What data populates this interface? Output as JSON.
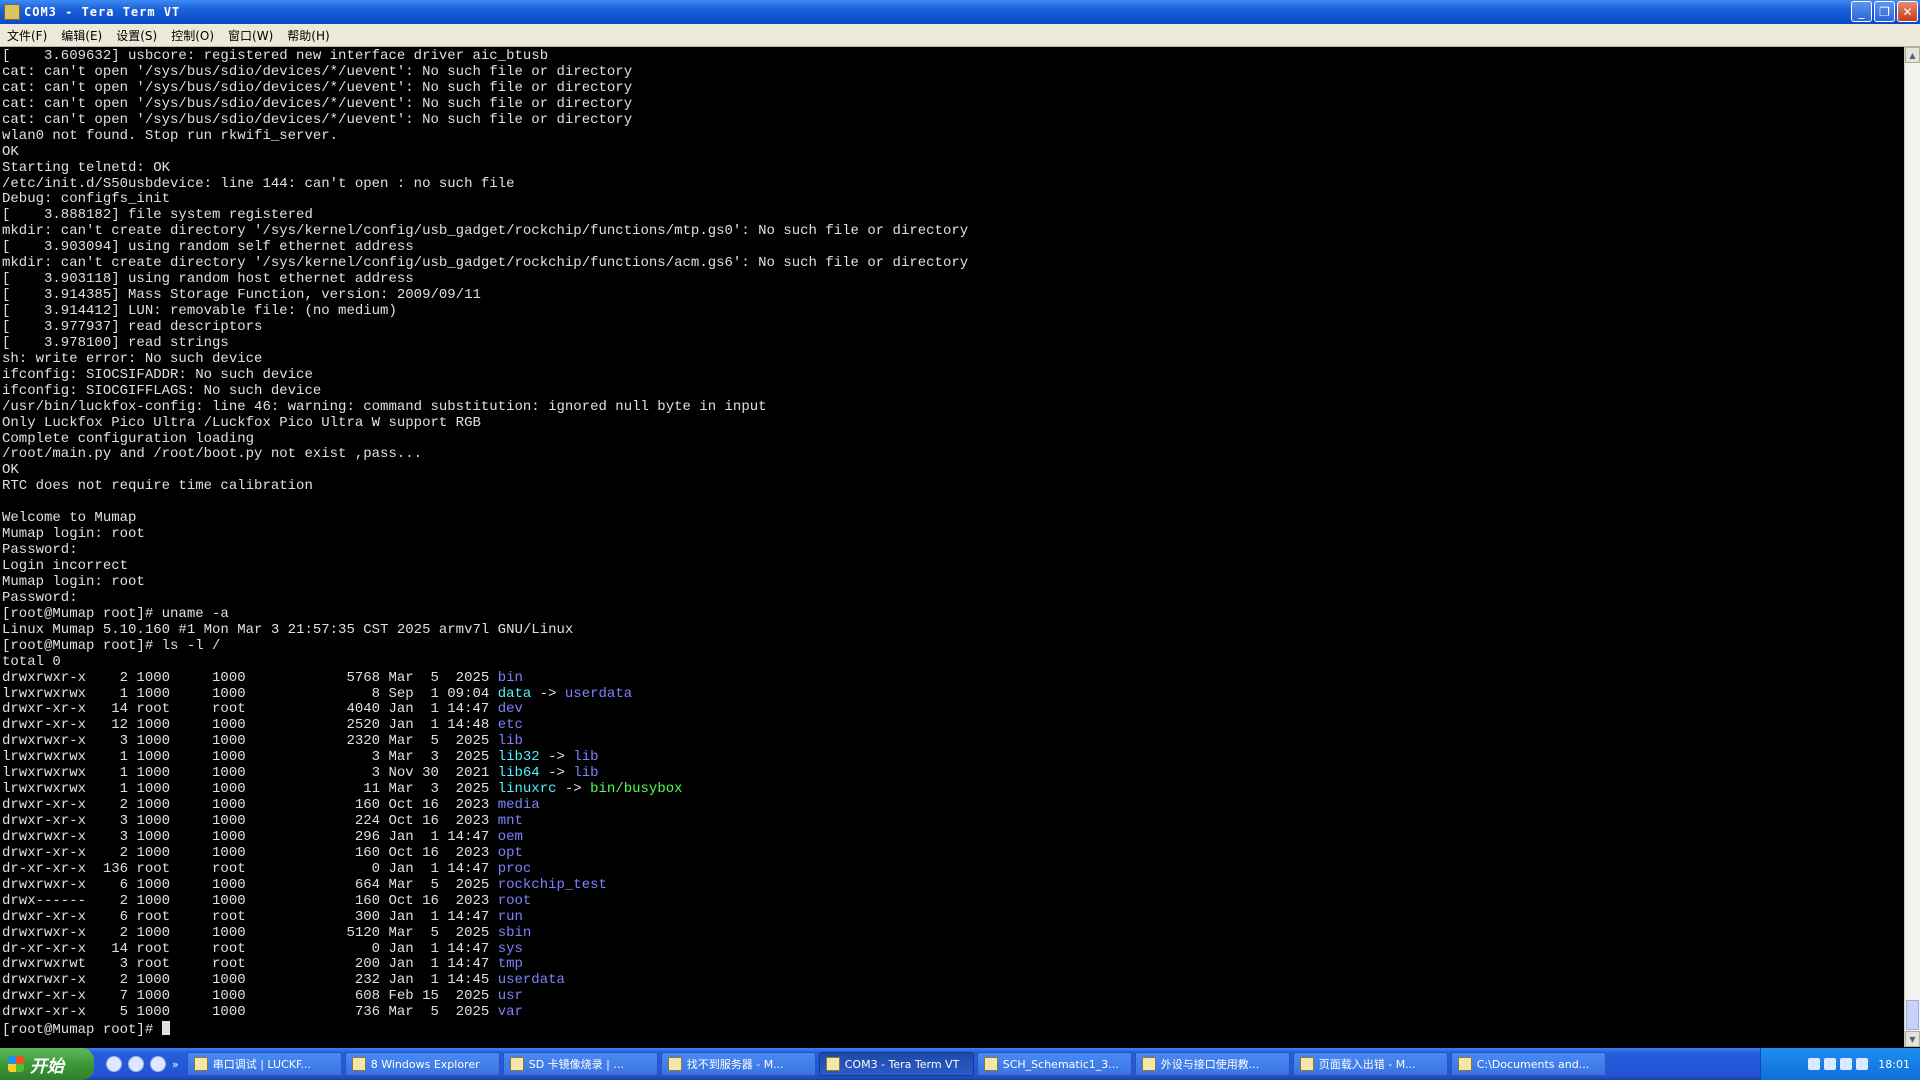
{
  "window": {
    "title": "COM3 - Tera Term VT",
    "minimize": "_",
    "maximize": "❐",
    "close": "✕"
  },
  "menu": [
    "文件(F)",
    "编辑(E)",
    "设置(S)",
    "控制(O)",
    "窗口(W)",
    "帮助(H)"
  ],
  "terminal": {
    "lines": [
      "[    3.609632] usbcore: registered new interface driver aic_btusb",
      "cat: can't open '/sys/bus/sdio/devices/*/uevent': No such file or directory",
      "cat: can't open '/sys/bus/sdio/devices/*/uevent': No such file or directory",
      "cat: can't open '/sys/bus/sdio/devices/*/uevent': No such file or directory",
      "cat: can't open '/sys/bus/sdio/devices/*/uevent': No such file or directory",
      "wlan0 not found. Stop run rkwifi_server.",
      "OK",
      "Starting telnetd: OK",
      "/etc/init.d/S50usbdevice: line 144: can't open : no such file",
      "Debug: configfs_init",
      "[    3.888182] file system registered",
      "mkdir: can't create directory '/sys/kernel/config/usb_gadget/rockchip/functions/mtp.gs0': No such file or directory",
      "[    3.903094] using random self ethernet address",
      "mkdir: can't create directory '/sys/kernel/config/usb_gadget/rockchip/functions/acm.gs6': No such file or directory",
      "[    3.903118] using random host ethernet address",
      "[    3.914385] Mass Storage Function, version: 2009/09/11",
      "[    3.914412] LUN: removable file: (no medium)",
      "[    3.977937] read descriptors",
      "[    3.978100] read strings",
      "sh: write error: No such device",
      "ifconfig: SIOCSIFADDR: No such device",
      "ifconfig: SIOCGIFFLAGS: No such device",
      "/usr/bin/luckfox-config: line 46: warning: command substitution: ignored null byte in input",
      "Only Luckfox Pico Ultra /Luckfox Pico Ultra W support RGB",
      "Complete configuration loading",
      "/root/main.py and /root/boot.py not exist ,pass...",
      "OK",
      "RTC does not require time calibration",
      "",
      "Welcome to Mumap",
      "Mumap login: root",
      "Password:",
      "Login incorrect",
      "Mumap login: root",
      "Password:",
      "[root@Mumap root]# uname -a",
      "Linux Mumap 5.10.160 #1 Mon Mar 3 21:57:35 CST 2025 armv7l GNU/Linux",
      "[root@Mumap root]# ls -l /",
      "total 0"
    ],
    "listing": [
      {
        "perm": "drwxrwxr-x",
        "links": "2",
        "owner": "1000",
        "group": "1000",
        "size": "5768",
        "date": "Mar  5  2025",
        "name": "bin",
        "type": "dir"
      },
      {
        "perm": "lrwxrwxrwx",
        "links": "1",
        "owner": "1000",
        "group": "1000",
        "size": "8",
        "date": "Sep  1 09:04",
        "name": "data",
        "type": "lnk",
        "target": "userdata",
        "target_type": "dir"
      },
      {
        "perm": "drwxr-xr-x",
        "links": "14",
        "owner": "root",
        "group": "root",
        "size": "4040",
        "date": "Jan  1 14:47",
        "name": "dev",
        "type": "dir"
      },
      {
        "perm": "drwxr-xr-x",
        "links": "12",
        "owner": "1000",
        "group": "1000",
        "size": "2520",
        "date": "Jan  1 14:48",
        "name": "etc",
        "type": "dir"
      },
      {
        "perm": "drwxrwxr-x",
        "links": "3",
        "owner": "1000",
        "group": "1000",
        "size": "2320",
        "date": "Mar  5  2025",
        "name": "lib",
        "type": "dir"
      },
      {
        "perm": "lrwxrwxrwx",
        "links": "1",
        "owner": "1000",
        "group": "1000",
        "size": "3",
        "date": "Mar  3  2025",
        "name": "lib32",
        "type": "lnk",
        "target": "lib",
        "target_type": "dir"
      },
      {
        "perm": "lrwxrwxrwx",
        "links": "1",
        "owner": "1000",
        "group": "1000",
        "size": "3",
        "date": "Nov 30  2021",
        "name": "lib64",
        "type": "lnk",
        "target": "lib",
        "target_type": "dir"
      },
      {
        "perm": "lrwxrwxrwx",
        "links": "1",
        "owner": "1000",
        "group": "1000",
        "size": "11",
        "date": "Mar  3  2025",
        "name": "linuxrc",
        "type": "lnk",
        "target": "bin/busybox",
        "target_type": "exe"
      },
      {
        "perm": "drwxr-xr-x",
        "links": "2",
        "owner": "1000",
        "group": "1000",
        "size": "160",
        "date": "Oct 16  2023",
        "name": "media",
        "type": "dir"
      },
      {
        "perm": "drwxr-xr-x",
        "links": "3",
        "owner": "1000",
        "group": "1000",
        "size": "224",
        "date": "Oct 16  2023",
        "name": "mnt",
        "type": "dir"
      },
      {
        "perm": "drwxrwxr-x",
        "links": "3",
        "owner": "1000",
        "group": "1000",
        "size": "296",
        "date": "Jan  1 14:47",
        "name": "oem",
        "type": "dir"
      },
      {
        "perm": "drwxr-xr-x",
        "links": "2",
        "owner": "1000",
        "group": "1000",
        "size": "160",
        "date": "Oct 16  2023",
        "name": "opt",
        "type": "dir"
      },
      {
        "perm": "dr-xr-xr-x",
        "links": "136",
        "owner": "root",
        "group": "root",
        "size": "0",
        "date": "Jan  1 14:47",
        "name": "proc",
        "type": "dir"
      },
      {
        "perm": "drwxrwxr-x",
        "links": "6",
        "owner": "1000",
        "group": "1000",
        "size": "664",
        "date": "Mar  5  2025",
        "name": "rockchip_test",
        "type": "dir"
      },
      {
        "perm": "drwx------",
        "links": "2",
        "owner": "1000",
        "group": "1000",
        "size": "160",
        "date": "Oct 16  2023",
        "name": "root",
        "type": "dir"
      },
      {
        "perm": "drwxr-xr-x",
        "links": "6",
        "owner": "root",
        "group": "root",
        "size": "300",
        "date": "Jan  1 14:47",
        "name": "run",
        "type": "dir"
      },
      {
        "perm": "drwxrwxr-x",
        "links": "2",
        "owner": "1000",
        "group": "1000",
        "size": "5120",
        "date": "Mar  5  2025",
        "name": "sbin",
        "type": "dir"
      },
      {
        "perm": "dr-xr-xr-x",
        "links": "14",
        "owner": "root",
        "group": "root",
        "size": "0",
        "date": "Jan  1 14:47",
        "name": "sys",
        "type": "dir"
      },
      {
        "perm": "drwxrwxrwt",
        "links": "3",
        "owner": "root",
        "group": "root",
        "size": "200",
        "date": "Jan  1 14:47",
        "name": "tmp",
        "type": "dir"
      },
      {
        "perm": "drwxrwxr-x",
        "links": "2",
        "owner": "1000",
        "group": "1000",
        "size": "232",
        "date": "Jan  1 14:45",
        "name": "userdata",
        "type": "dir"
      },
      {
        "perm": "drwxr-xr-x",
        "links": "7",
        "owner": "1000",
        "group": "1000",
        "size": "608",
        "date": "Feb 15  2025",
        "name": "usr",
        "type": "dir"
      },
      {
        "perm": "drwxr-xr-x",
        "links": "5",
        "owner": "1000",
        "group": "1000",
        "size": "736",
        "date": "Mar  5  2025",
        "name": "var",
        "type": "dir"
      }
    ],
    "prompt": "[root@Mumap root]# "
  },
  "colors": {
    "dir": "#8080ff",
    "link": "#4ff0ff",
    "exe": "#50ff50",
    "text": "#e0e0e0",
    "bg": "#000000"
  },
  "taskbar": {
    "start_label": "开始",
    "more": "»",
    "tasks": [
      {
        "label": "串口调试 | LUCKF...",
        "active": false
      },
      {
        "label": "8 Windows Explorer",
        "active": false
      },
      {
        "label": "SD 卡镜像烧录 | ...",
        "active": false
      },
      {
        "label": "找不到服务器 - M...",
        "active": false
      },
      {
        "label": "COM3 - Tera Term VT",
        "active": true
      },
      {
        "label": "SCH_Schematic1_3...",
        "active": false
      },
      {
        "label": "外设与接口使用教...",
        "active": false
      },
      {
        "label": "页面载入出错 - M...",
        "active": false
      },
      {
        "label": "C:\\Documents and...",
        "active": false
      }
    ],
    "clock": "18:01"
  }
}
